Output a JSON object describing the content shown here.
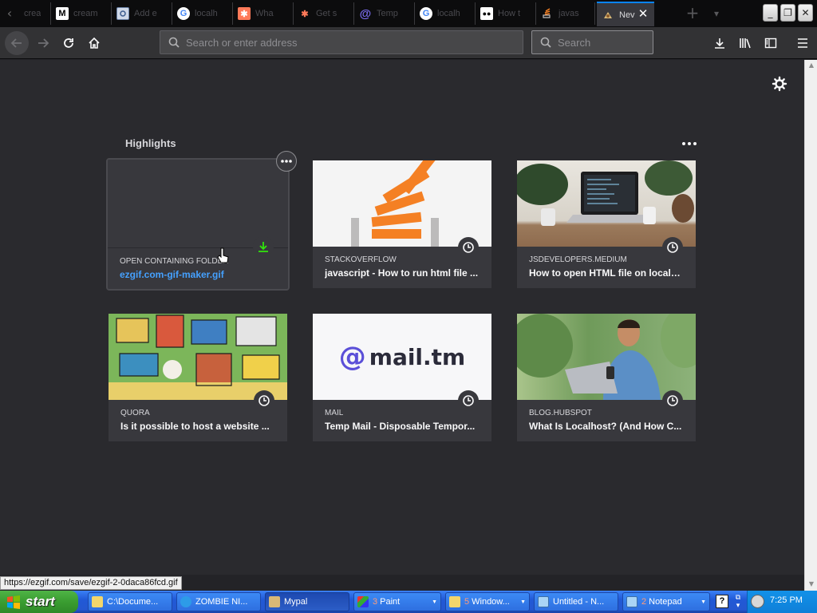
{
  "tabs": [
    {
      "title": "crea",
      "favicon": "blank-tab-icon",
      "active": false
    },
    {
      "title": "cream",
      "favicon": "medium-m-icon",
      "active": false
    },
    {
      "title": "Add e",
      "favicon": "gear-page-icon",
      "active": false
    },
    {
      "title": "localh",
      "favicon": "google-g-icon",
      "active": false
    },
    {
      "title": "Wha",
      "favicon": "hubspot-icon",
      "active": false
    },
    {
      "title": "Get s",
      "favicon": "hubspot-icon",
      "active": false
    },
    {
      "title": "Temp",
      "favicon": "at-sign-icon",
      "active": false
    },
    {
      "title": "localh",
      "favicon": "google-g-icon",
      "active": false
    },
    {
      "title": "How t",
      "favicon": "medium-dots-icon",
      "active": false
    },
    {
      "title": "javas",
      "favicon": "stackoverflow-icon",
      "active": false
    },
    {
      "title": "Nev",
      "favicon": "firefox-newtab-icon",
      "active": true
    }
  ],
  "nav": {
    "url_placeholder": "Search or enter address",
    "search_placeholder": "Search"
  },
  "highlights": {
    "title": "Highlights",
    "cards": [
      {
        "source": "OPEN CONTAINING FOLDER",
        "title": "ezgif.com-gif-maker.gif",
        "badge": "download-icon",
        "thumb": "empty"
      },
      {
        "source": "STACKOVERFLOW",
        "title": "javascript - How to run html file ...",
        "badge": "clock-icon",
        "thumb": "stackoverflow"
      },
      {
        "source": "JSDEVELOPERS.MEDIUM",
        "title": "How to open HTML file on localh...",
        "badge": "clock-icon",
        "thumb": "laptop-desk"
      },
      {
        "source": "QUORA",
        "title": "Is it possible to host a website ...",
        "badge": "clock-icon",
        "thumb": "illustration"
      },
      {
        "source": "MAIL",
        "title": "Temp Mail - Disposable Tempor...",
        "badge": "clock-icon",
        "thumb": "mailtm"
      },
      {
        "source": "BLOG.HUBSPOT",
        "title": "What Is Localhost? (And How C...",
        "badge": "clock-icon",
        "thumb": "man-laptop"
      }
    ]
  },
  "thumbs": {
    "mailtm_logo": "mail.tm",
    "mailtm_at": "@"
  },
  "status_url": "https://ezgif.com/save/ezgif-2-0daca86fcd.gif",
  "taskbar": {
    "start": "start",
    "items": [
      {
        "label": "C:\\Docume...",
        "count": "",
        "group": false
      },
      {
        "label": "ZOMBIE NI...",
        "count": "",
        "group": false
      },
      {
        "label": "Mypal",
        "count": "",
        "group": false,
        "active": true
      },
      {
        "label": "Paint",
        "count": "3",
        "group": true
      },
      {
        "label": "Window...",
        "count": "5",
        "group": true
      },
      {
        "label": "Untitled - N...",
        "count": "",
        "group": false
      },
      {
        "label": "Notepad",
        "count": "2",
        "group": true
      }
    ],
    "clock": "7:25 PM"
  },
  "colors": {
    "accent": "#0a84ff",
    "link": "#45a1ff",
    "download_badge": "#30e60b",
    "stackoverflow_orange": "#f48024",
    "mailtm_purple": "#5b4fd8"
  }
}
